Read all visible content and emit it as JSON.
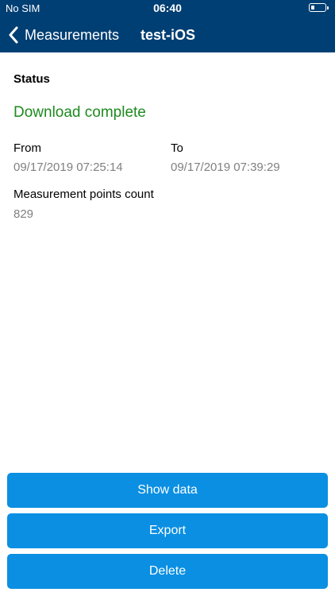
{
  "status_bar": {
    "carrier": "No SIM",
    "time": "06:40",
    "battery_level": 0.25
  },
  "nav": {
    "back_label": "Measurements",
    "title": "test-iOS"
  },
  "details": {
    "status_heading": "Status",
    "status_value": "Download complete",
    "from_label": "From",
    "from_value": "09/17/2019 07:25:14",
    "to_label": "To",
    "to_value": "09/17/2019 07:39:29",
    "points_label": "Measurement points count",
    "points_value": "829"
  },
  "actions": {
    "show_data_label": "Show data",
    "export_label": "Export",
    "delete_label": "Delete"
  },
  "colors": {
    "header_background": "#003F73",
    "button_background": "#0A8FE3",
    "status_text": "#1E8A1E",
    "value_text": "#808080"
  },
  "icons": {
    "back": "chevron-left-icon",
    "battery": "battery-icon"
  }
}
